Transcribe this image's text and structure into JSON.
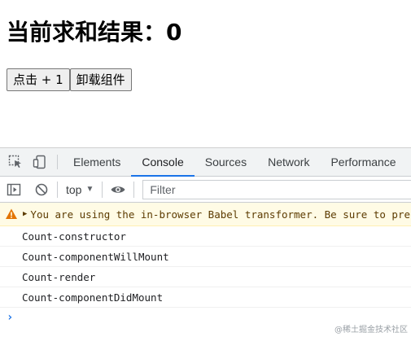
{
  "page": {
    "heading": "当前求和结果：0",
    "buttons": {
      "increment": "点击 + 1",
      "unmount": "卸载组件"
    }
  },
  "devtools": {
    "tabs": [
      {
        "label": "Elements"
      },
      {
        "label": "Console"
      },
      {
        "label": "Sources"
      },
      {
        "label": "Network"
      },
      {
        "label": "Performance"
      }
    ],
    "active_tab": "Console",
    "toolbar": {
      "context": "top",
      "filter_placeholder": "Filter"
    },
    "console": {
      "warning": "You are using the in-browser Babel transformer. Be sure to precompile your scripts for production",
      "logs": [
        "Count-constructor",
        "Count-componentWillMount",
        "Count-render",
        "Count-componentDidMount"
      ],
      "prompt_symbol": "›"
    },
    "colors": {
      "accent": "#1a73e8",
      "warning_bg": "#fffbe5",
      "warning_text": "#5c3b00",
      "tabbar_bg": "#f1f3f4"
    }
  },
  "watermark": "@稀土掘金技术社区"
}
